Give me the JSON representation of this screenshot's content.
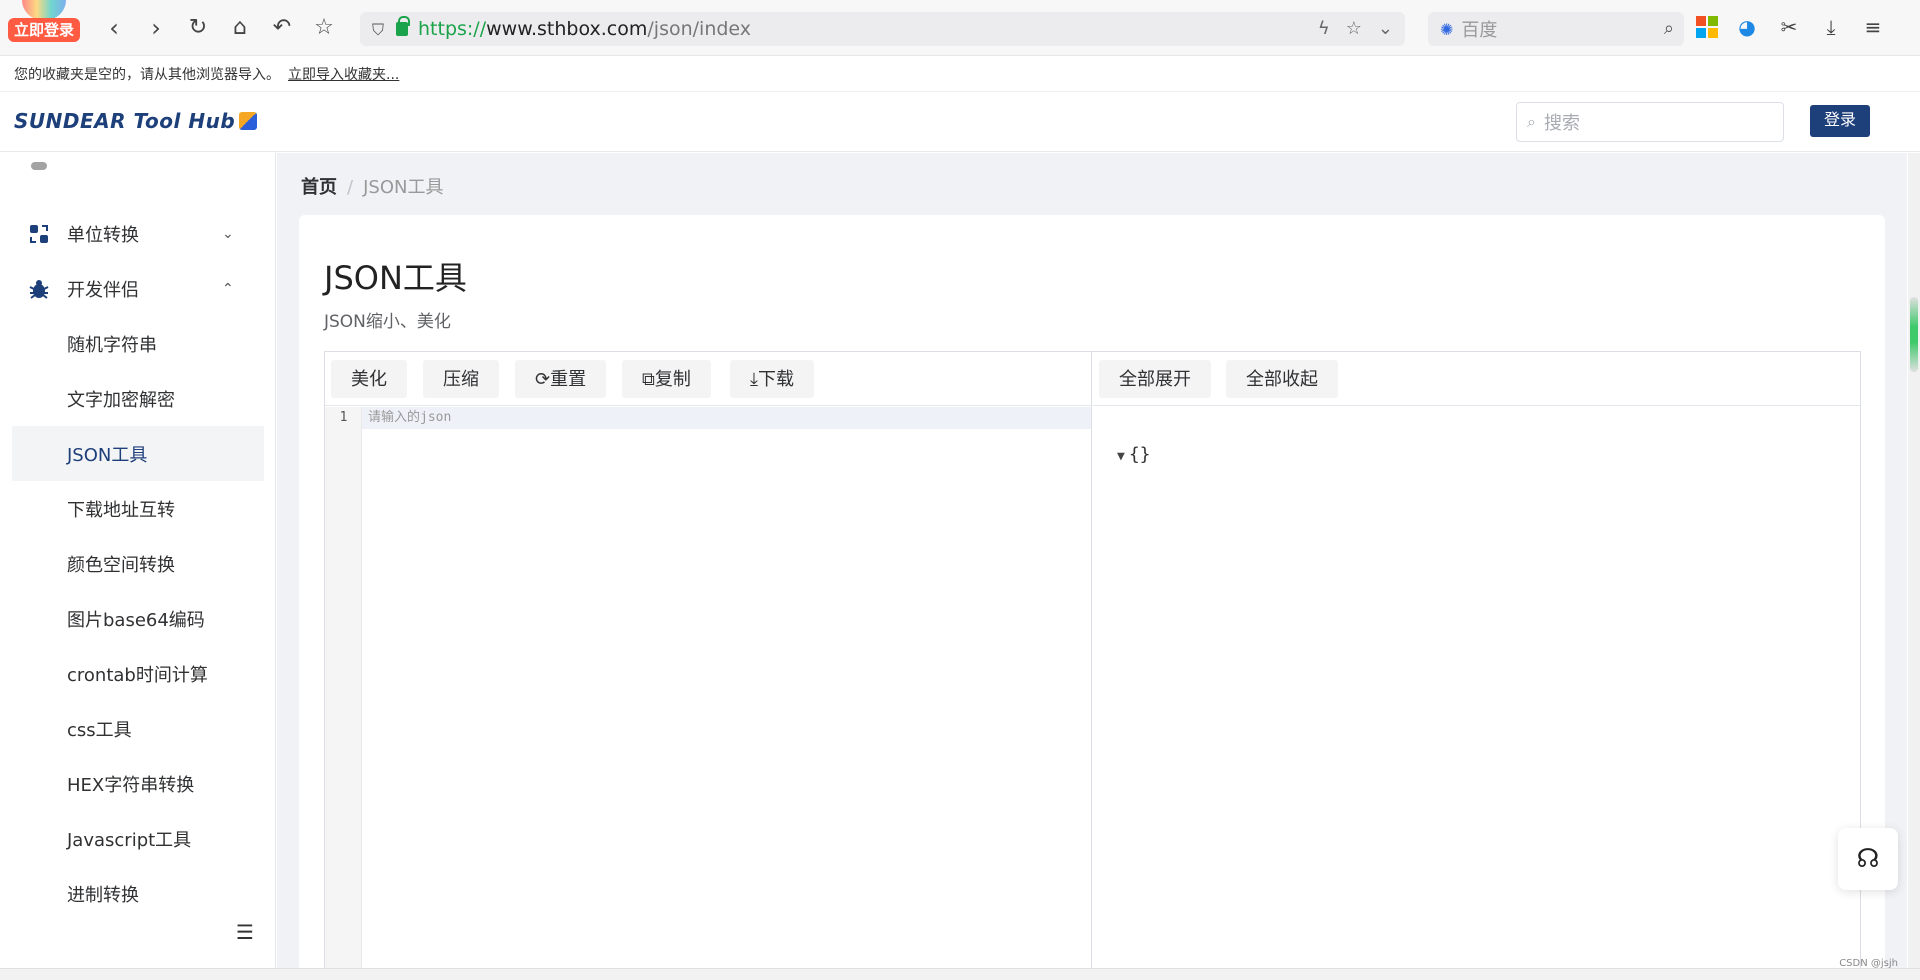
{
  "browser": {
    "login_badge": "立即登录",
    "url_scheme": "https://",
    "url_host": "www.sthbox.com",
    "url_path": "/json/index",
    "search_placeholder": "百度"
  },
  "bookmarks": {
    "empty_message": "您的收藏夹是空的，请从其他浏览器导入。",
    "import_link": "立即导入收藏夹..."
  },
  "header": {
    "brand": "SUNDEAR Tool Hub",
    "search_placeholder": "搜索",
    "login_label": "登录"
  },
  "sidebar": {
    "groups": [
      {
        "label": "单位转换",
        "icon": "convert-icon",
        "expanded": false
      },
      {
        "label": "开发伴侣",
        "icon": "bug-icon",
        "expanded": true
      }
    ],
    "items": [
      {
        "label": "随机字符串"
      },
      {
        "label": "文字加密解密"
      },
      {
        "label": "JSON工具",
        "active": true
      },
      {
        "label": "下载地址互转"
      },
      {
        "label": "颜色空间转换"
      },
      {
        "label": "图片base64编码"
      },
      {
        "label": "crontab时间计算"
      },
      {
        "label": "css工具"
      },
      {
        "label": "HEX字符串转换"
      },
      {
        "label": "Javascript工具"
      },
      {
        "label": "进制转换"
      }
    ]
  },
  "breadcrumb": {
    "home": "首页",
    "separator": "/",
    "current": "JSON工具"
  },
  "page": {
    "title": "JSON工具",
    "subtitle": "JSON缩小、美化"
  },
  "editor": {
    "left_toolbar": [
      {
        "label": "美化"
      },
      {
        "label": "压缩"
      },
      {
        "label": "重置",
        "icon": "refresh-icon"
      },
      {
        "label": "复制",
        "icon": "copy-icon"
      },
      {
        "label": "下载",
        "icon": "download-icon"
      }
    ],
    "right_toolbar": [
      {
        "label": "全部展开"
      },
      {
        "label": "全部收起"
      }
    ],
    "line_number": "1",
    "placeholder": "请输入的json",
    "tree_root": "{}"
  },
  "footer": {
    "watermark": "CSDN @jsjh"
  },
  "colors": {
    "brand": "#1d3f7a",
    "accent_green": "#1aa34a",
    "login_badge": "#ff5b42"
  }
}
